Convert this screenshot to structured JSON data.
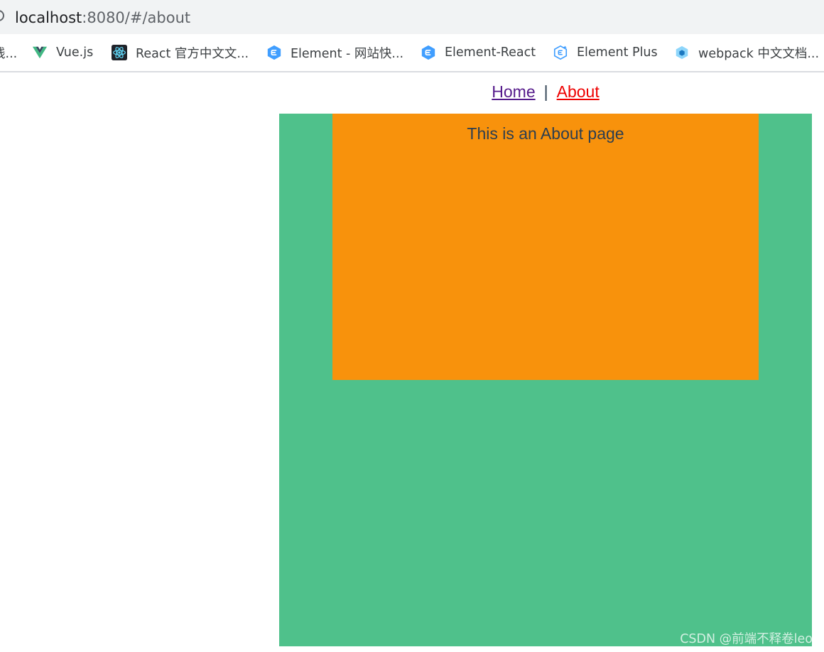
{
  "address_bar": {
    "url_host": "localhost",
    "url_rest": ":8080/#/about"
  },
  "bookmarks": [
    {
      "label": "线...",
      "icon": "folder-icon"
    },
    {
      "label": "Vue.js",
      "icon": "vue-logo-icon"
    },
    {
      "label": "React 官方中文文...",
      "icon": "react-logo-icon"
    },
    {
      "label": "Element - 网站快...",
      "icon": "element-logo-icon"
    },
    {
      "label": "Element-React",
      "icon": "element-logo-icon"
    },
    {
      "label": "Element Plus",
      "icon": "element-plus-logo-icon"
    },
    {
      "label": "webpack 中文文档...",
      "icon": "webpack-logo-icon"
    }
  ],
  "nav": {
    "home": "Home",
    "separator": "|",
    "about": "About"
  },
  "content": {
    "about_text": "This is an About page"
  },
  "watermark": "CSDN @前端不释卷leo",
  "colors": {
    "green": "#4fc18b",
    "orange": "#f8920c",
    "visited_link": "#551a8b",
    "active_link": "#ee0000",
    "text": "#2c3e50"
  }
}
